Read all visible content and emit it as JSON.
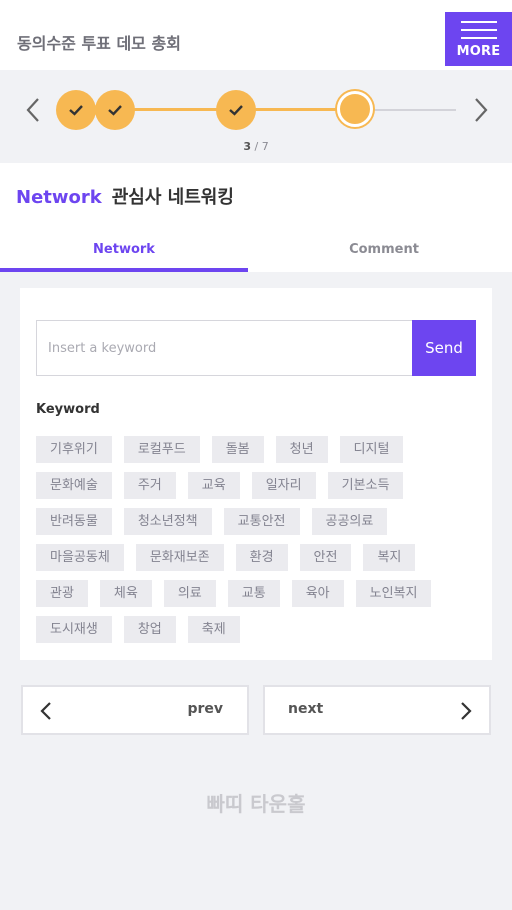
{
  "header": {
    "title": "동의수준 투표 데모 총회",
    "menu_label": "MORE"
  },
  "progress": {
    "current": "3",
    "total": "7",
    "separator": "/"
  },
  "section": {
    "title_en": "Network",
    "title_ko": "관심사 네트워킹"
  },
  "tabs": [
    {
      "label": "Network",
      "active": true
    },
    {
      "label": "Comment",
      "active": false
    }
  ],
  "keyword_input": {
    "value": "",
    "placeholder": "Insert a keyword",
    "send_label": "Send"
  },
  "keywords": {
    "label": "Keyword",
    "rows": [
      [
        "기후위기",
        "로컬푸드",
        "돌봄",
        "청년",
        "디지털"
      ],
      [
        "문화예술",
        "주거",
        "교육",
        "일자리",
        "기본소득"
      ],
      [
        "반려동물",
        "청소년정책",
        "교통안전",
        "공공의료"
      ],
      [
        "마을공동체",
        "문화재보존",
        "환경",
        "안전",
        "복지"
      ],
      [
        "관광",
        "체육",
        "의료",
        "교통",
        "육아",
        "노인복지"
      ],
      [
        "도시재생",
        "창업",
        "축제"
      ]
    ]
  },
  "pager": {
    "prev_label": "prev",
    "next_label": "next"
  },
  "footer": {
    "brand": "빠띠 타운홀"
  },
  "colors": {
    "accent": "#6d45f0",
    "step": "#f7b852"
  }
}
